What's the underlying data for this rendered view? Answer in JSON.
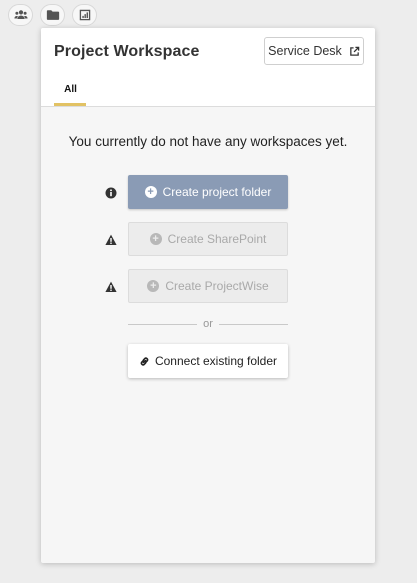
{
  "toolbar": {
    "buttons": [
      {
        "icon": "users-icon"
      },
      {
        "icon": "folder-icon"
      },
      {
        "icon": "chart-icon"
      }
    ]
  },
  "panel": {
    "title": "Project Workspace",
    "service_desk_label": "Service Desk",
    "tabs": [
      {
        "label": "All",
        "active": true
      }
    ],
    "empty_message": "You currently do not have any workspaces yet.",
    "actions": [
      {
        "label": "Create project folder",
        "status_icon": "info-icon",
        "enabled": true
      },
      {
        "label": "Create SharePoint",
        "status_icon": "warning-icon",
        "enabled": false
      },
      {
        "label": "Create ProjectWise",
        "status_icon": "warning-icon",
        "enabled": false
      }
    ],
    "divider_text": "or",
    "connect_label": "Connect existing folder"
  },
  "colors": {
    "accent_tab": "#e2c264",
    "primary_button": "#8a9bb5"
  }
}
